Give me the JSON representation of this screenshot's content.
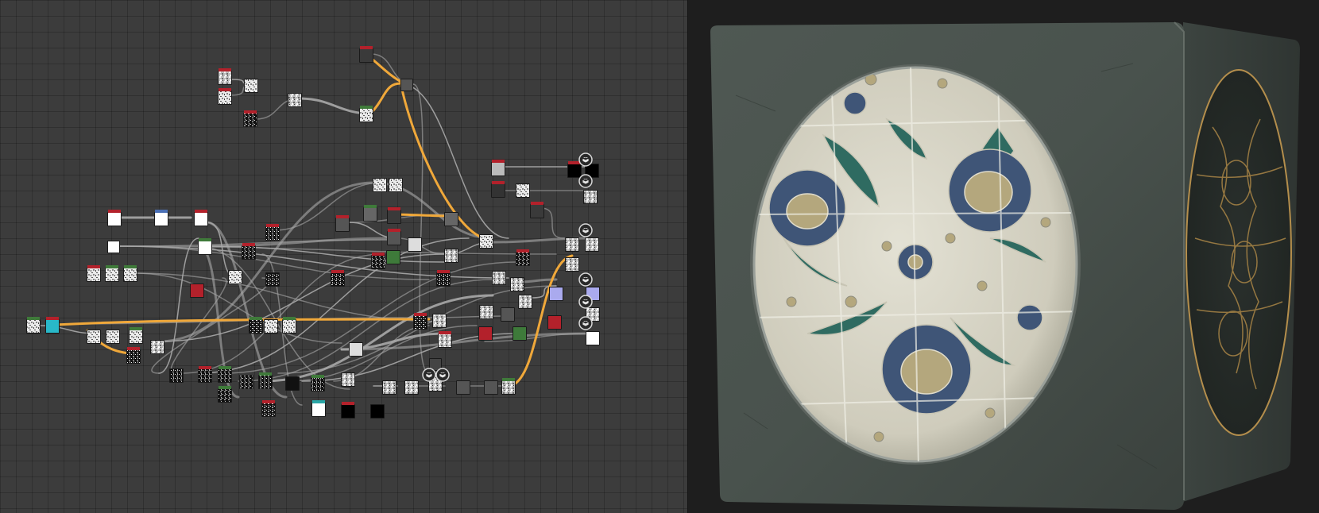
{
  "graph": {
    "background": "#3c3c3c",
    "wire_color": "#a8a8a8",
    "highlight_wire_color": "#f0a83a",
    "node_header_colors": {
      "red": "#b3212b",
      "green": "#3f7a3a",
      "blue": "#4a6fb5",
      "gray": "#777777",
      "teal": "#2aa6a6"
    },
    "output_icon": "cube-output-icon"
  },
  "viewport": {
    "background": "#1e1e1e",
    "subject": "3d-cube-preview",
    "material_colors": {
      "base": "#4a514c",
      "tile": "#d6d3c4",
      "petal": "#3f5577",
      "leaf": "#2f6b61",
      "core": "#b4a77d",
      "metal": "#c8b98a"
    }
  }
}
